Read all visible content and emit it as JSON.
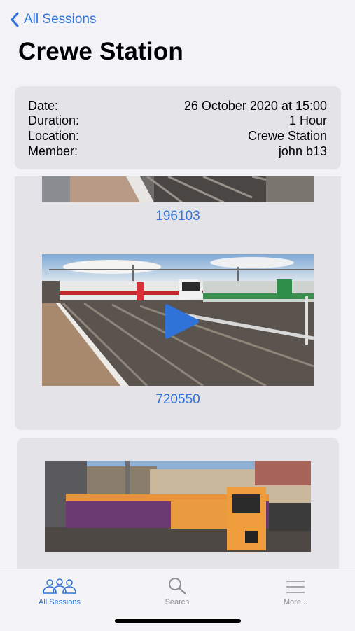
{
  "nav": {
    "back_label": "All Sessions",
    "title": "Crewe Station"
  },
  "session_info": {
    "rows": [
      {
        "label": "Date:",
        "value": "26 October 2020 at 15:00"
      },
      {
        "label": "Duration:",
        "value": "1 Hour"
      },
      {
        "label": "Location:",
        "value": "Crewe Station"
      },
      {
        "label": "Member:",
        "value": "john  b13"
      }
    ]
  },
  "videos": [
    {
      "caption": "196103"
    },
    {
      "caption": "720550",
      "has_play_button": true
    },
    {
      "caption": ""
    }
  ],
  "tab_bar": {
    "tabs": [
      {
        "label": "All Sessions",
        "icon": "people-icon",
        "selected": true
      },
      {
        "label": "Search",
        "icon": "search-icon",
        "selected": false
      },
      {
        "label": "More...",
        "icon": "more-lines-icon",
        "selected": false
      }
    ]
  },
  "colors": {
    "accent": "#2f73d9",
    "background": "#f2f2f7",
    "card": "#e4e4e8",
    "tab_inactive": "#8e8e93"
  }
}
